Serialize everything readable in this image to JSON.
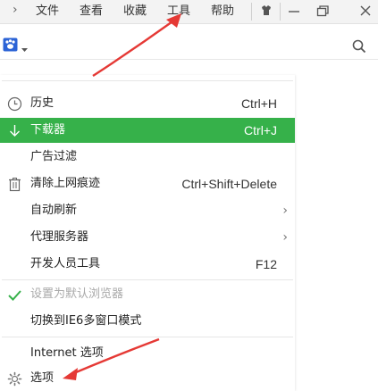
{
  "menubar": {
    "items": [
      "文件",
      "查看",
      "收藏",
      "工具",
      "帮助"
    ]
  },
  "menu": {
    "items": [
      {
        "label": "历史",
        "shortcut": "Ctrl+H"
      },
      {
        "label": "下载器",
        "shortcut": "Ctrl+J"
      },
      {
        "label": "广告过滤",
        "shortcut": ""
      },
      {
        "label": "清除上网痕迹",
        "shortcut": "Ctrl+Shift+Delete"
      },
      {
        "label": "自动刷新",
        "shortcut": ""
      },
      {
        "label": "代理服务器",
        "shortcut": ""
      },
      {
        "label": "开发人员工具",
        "shortcut": "F12"
      },
      {
        "label": "设置为默认浏览器",
        "shortcut": ""
      },
      {
        "label": "切换到IE6多窗口模式",
        "shortcut": ""
      },
      {
        "label": "Internet 选项",
        "shortcut": ""
      },
      {
        "label": "选项",
        "shortcut": ""
      }
    ]
  },
  "colors": {
    "highlight": "#36b14a",
    "annotation_arrow": "#e53935"
  },
  "icons": {
    "history": "clock-icon",
    "downloader": "download-arrow-icon",
    "clear": "trash-icon",
    "default_browser": "check-icon",
    "options": "gear-icon",
    "search": "search-icon",
    "skin": "shirt-icon"
  }
}
